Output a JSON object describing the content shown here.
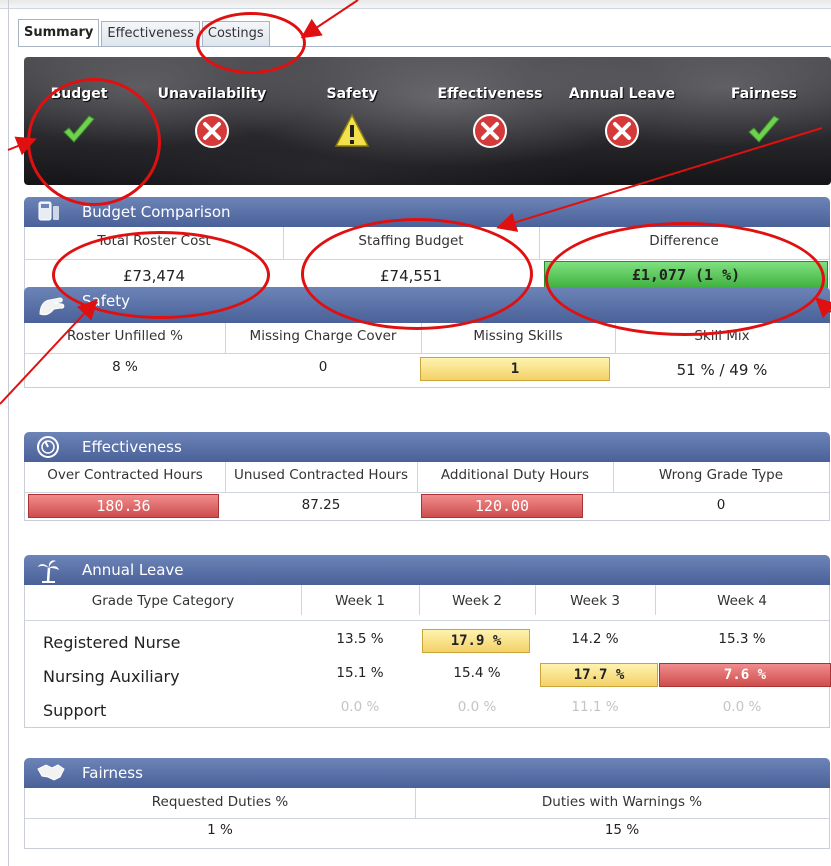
{
  "tabs": [
    "Summary",
    "Effectiveness",
    "Costings"
  ],
  "banner": {
    "statuses": [
      {
        "label": "Budget",
        "icon": "check-icon"
      },
      {
        "label": "Unavailability",
        "icon": "error-icon"
      },
      {
        "label": "Safety",
        "icon": "warning-icon"
      },
      {
        "label": "Effectiveness",
        "icon": "error-icon"
      },
      {
        "label": "Annual Leave",
        "icon": "error-icon"
      },
      {
        "label": "Fairness",
        "icon": "check-icon"
      }
    ]
  },
  "budget": {
    "title": "Budget Comparison",
    "headers": [
      "Total Roster Cost",
      "Staffing Budget",
      "Difference"
    ],
    "values": [
      "£73,474",
      "£74,551",
      "£1,077 (1 %)"
    ]
  },
  "safety": {
    "title": "Safety",
    "headers": [
      "Roster Unfilled %",
      "Missing Charge Cover",
      "Missing Skills",
      "Skill Mix"
    ],
    "values": [
      "8 %",
      "0",
      "1",
      "51 % / 49 %"
    ]
  },
  "effectiveness": {
    "title": "Effectiveness",
    "headers": [
      "Over Contracted Hours",
      "Unused Contracted Hours",
      "Additional Duty Hours",
      "Wrong Grade Type"
    ],
    "values": [
      "180.36",
      "87.25",
      "120.00",
      "0"
    ]
  },
  "annual_leave": {
    "title": "Annual Leave",
    "headers": [
      "Grade Type Category",
      "Week 1",
      "Week 2",
      "Week 3",
      "Week 4"
    ],
    "rows": [
      {
        "category": "Registered Nurse",
        "weeks": [
          "13.5 %",
          "17.9 %",
          "14.2 %",
          "15.3 %"
        ]
      },
      {
        "category": "Nursing Auxiliary",
        "weeks": [
          "15.1 %",
          "15.4 %",
          "17.7 %",
          "7.6 %"
        ]
      },
      {
        "category": "Support",
        "weeks": [
          "0.0 %",
          "0.0 %",
          "11.1 %",
          "0.0 %"
        ]
      }
    ]
  },
  "fairness": {
    "title": "Fairness",
    "headers": [
      "Requested Duties %",
      "Duties with Warnings %"
    ],
    "values": [
      "1 %",
      "15 %"
    ]
  },
  "colors": {
    "header_blue": "#4a6199",
    "ok_green": "#3fb13f",
    "warn_yellow": "#f3d167",
    "bad_red": "#cf4d4d",
    "annotation_red": "#e01010"
  }
}
